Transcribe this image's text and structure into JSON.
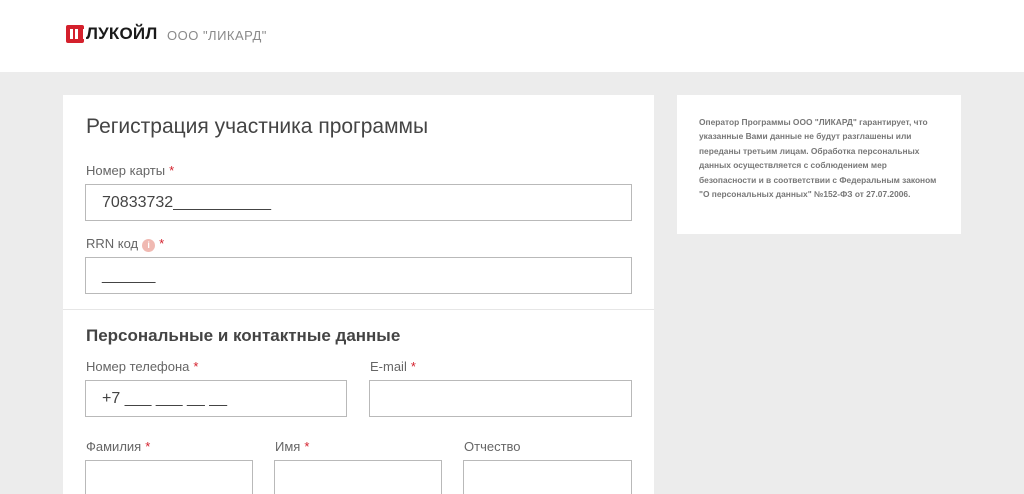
{
  "header": {
    "brand": "ЛУКОЙЛ",
    "company": "ООО \"ЛИКАРД\""
  },
  "form": {
    "title": "Регистрация участника программы",
    "card_number": {
      "label": "Номер карты",
      "required_mark": "*",
      "value": "70833732___________"
    },
    "rrn": {
      "label": "RRN код",
      "info_icon": "info-icon",
      "info_glyph": "i",
      "required_mark": "*",
      "value": "______"
    },
    "section_title": "Персональные и контактные данные",
    "phone": {
      "label": "Номер телефона",
      "required_mark": "*",
      "value": "+7 ___ ___ __ __"
    },
    "email": {
      "label": "E-mail",
      "required_mark": "*",
      "value": ""
    },
    "surname": {
      "label": "Фамилия",
      "required_mark": "*",
      "value": ""
    },
    "name": {
      "label": "Имя",
      "required_mark": "*",
      "value": ""
    },
    "patronymic": {
      "label": "Отчество",
      "value": ""
    }
  },
  "notice": {
    "text": "Оператор Программы ООО \"ЛИКАРД\" гарантирует, что указанные Вами данные не будут разглашены или переданы третьим лицам. Обработка персональных данных осуществляется с соблюдением мер безопасности и в соответствии с Федеральным законом \"О персональных данных\" №152-ФЗ от 27.07.2006."
  },
  "colors": {
    "accent": "#d4202c",
    "background": "#ececec",
    "card": "#ffffff",
    "border": "#b9b9b9"
  }
}
